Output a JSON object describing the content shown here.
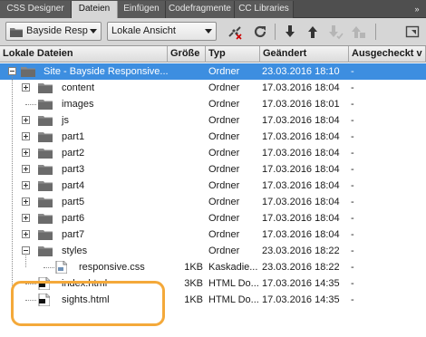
{
  "tabs": [
    {
      "label": "CSS Designer",
      "active": false
    },
    {
      "label": "Dateien",
      "active": true
    },
    {
      "label": "Einfügen",
      "active": false
    },
    {
      "label": "Codefragmente",
      "active": false
    },
    {
      "label": "CC Libraries",
      "active": false
    }
  ],
  "tab_menu_icon": "double-chevron-right",
  "toolbar": {
    "site_select": "Bayside Resp",
    "view_select": "Lokale Ansicht",
    "icons": [
      "disconnect-icon",
      "refresh-icon",
      "get-files-icon",
      "put-files-icon",
      "check-out-icon",
      "check-in-icon",
      "expand-icon"
    ]
  },
  "columns": {
    "name": "Lokale Dateien",
    "size": "Größe",
    "type": "Typ",
    "modified": "Geändert",
    "checked_out": "Ausgecheckt v"
  },
  "rows": [
    {
      "name": "Site - Bayside Responsive...",
      "size": "",
      "type": "Ordner",
      "modified": "23.03.2016 18:10",
      "checked_out": "-",
      "icon": "folder",
      "level": 0,
      "expander": "minus",
      "selected": true
    },
    {
      "name": "content",
      "size": "",
      "type": "Ordner",
      "modified": "17.03.2016 18:04",
      "checked_out": "-",
      "icon": "folder",
      "level": 1,
      "expander": "plus"
    },
    {
      "name": "images",
      "size": "",
      "type": "Ordner",
      "modified": "17.03.2016 18:01",
      "checked_out": "-",
      "icon": "folder",
      "level": 1,
      "expander": "none"
    },
    {
      "name": "js",
      "size": "",
      "type": "Ordner",
      "modified": "17.03.2016 18:04",
      "checked_out": "-",
      "icon": "folder",
      "level": 1,
      "expander": "plus"
    },
    {
      "name": "part1",
      "size": "",
      "type": "Ordner",
      "modified": "17.03.2016 18:04",
      "checked_out": "-",
      "icon": "folder",
      "level": 1,
      "expander": "plus"
    },
    {
      "name": "part2",
      "size": "",
      "type": "Ordner",
      "modified": "17.03.2016 18:04",
      "checked_out": "-",
      "icon": "folder",
      "level": 1,
      "expander": "plus"
    },
    {
      "name": "part3",
      "size": "",
      "type": "Ordner",
      "modified": "17.03.2016 18:04",
      "checked_out": "-",
      "icon": "folder",
      "level": 1,
      "expander": "plus"
    },
    {
      "name": "part4",
      "size": "",
      "type": "Ordner",
      "modified": "17.03.2016 18:04",
      "checked_out": "-",
      "icon": "folder",
      "level": 1,
      "expander": "plus"
    },
    {
      "name": "part5",
      "size": "",
      "type": "Ordner",
      "modified": "17.03.2016 18:04",
      "checked_out": "-",
      "icon": "folder",
      "level": 1,
      "expander": "plus"
    },
    {
      "name": "part6",
      "size": "",
      "type": "Ordner",
      "modified": "17.03.2016 18:04",
      "checked_out": "-",
      "icon": "folder",
      "level": 1,
      "expander": "plus"
    },
    {
      "name": "part7",
      "size": "",
      "type": "Ordner",
      "modified": "17.03.2016 18:04",
      "checked_out": "-",
      "icon": "folder",
      "level": 1,
      "expander": "plus"
    },
    {
      "name": "styles",
      "size": "",
      "type": "Ordner",
      "modified": "23.03.2016 18:22",
      "checked_out": "-",
      "icon": "folder",
      "level": 1,
      "expander": "minus"
    },
    {
      "name": "responsive.css",
      "size": "1KB",
      "type": "Kaskadie...",
      "modified": "23.03.2016 18:22",
      "checked_out": "-",
      "icon": "css-file",
      "level": 2,
      "expander": "none"
    },
    {
      "name": "index.html",
      "size": "3KB",
      "type": "HTML Do...",
      "modified": "17.03.2016 14:35",
      "checked_out": "-",
      "icon": "html-file",
      "level": 1,
      "expander": "none"
    },
    {
      "name": "sights.html",
      "size": "1KB",
      "type": "HTML Do...",
      "modified": "17.03.2016 14:35",
      "checked_out": "-",
      "icon": "html-file",
      "level": 1,
      "expander": "none"
    }
  ],
  "colors": {
    "selection": "#3d8ee0",
    "highlight_ring": "#f4a93a",
    "tab_bar": "#4f4f4f",
    "panel_bg": "#d6d6d6"
  }
}
